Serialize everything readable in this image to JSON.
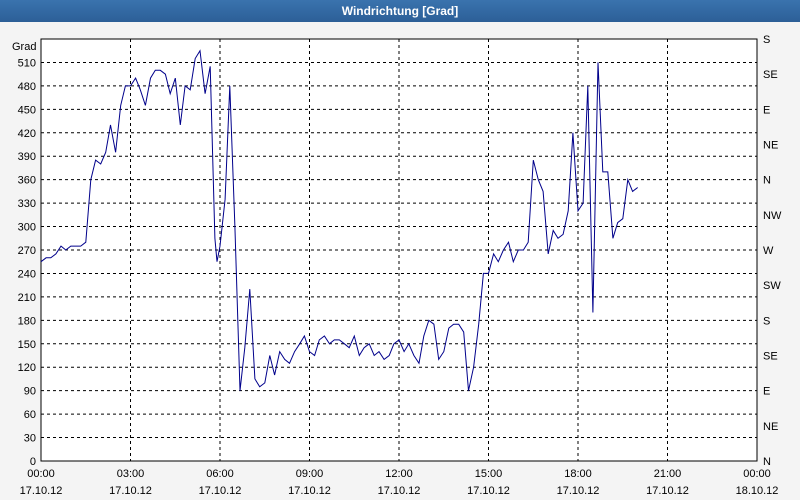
{
  "window": {
    "title": "Windrichtung [Grad]"
  },
  "chart_data": {
    "type": "line",
    "title": "Windrichtung [Grad]",
    "ylabel": "Grad",
    "ylim": [
      0,
      540
    ],
    "grid": true,
    "y_ticks": [
      "0",
      "30",
      "60",
      "90",
      "120",
      "150",
      "180",
      "210",
      "240",
      "270",
      "300",
      "330",
      "360",
      "390",
      "420",
      "450",
      "480",
      "510"
    ],
    "right_ticks": [
      "N",
      "NE",
      "E",
      "SE",
      "S",
      "SW",
      "W",
      "NW",
      "N",
      "NE",
      "E",
      "SE",
      "S"
    ],
    "x_ticks": [
      {
        "time": "00:00",
        "date": "17.10.12"
      },
      {
        "time": "03:00",
        "date": "17.10.12"
      },
      {
        "time": "06:00",
        "date": "17.10.12"
      },
      {
        "time": "09:00",
        "date": "17.10.12"
      },
      {
        "time": "12:00",
        "date": "17.10.12"
      },
      {
        "time": "15:00",
        "date": "17.10.12"
      },
      {
        "time": "18:00",
        "date": "17.10.12"
      },
      {
        "time": "21:00",
        "date": "17.10.12"
      },
      {
        "time": "00:00",
        "date": "18.10.12"
      }
    ],
    "line_color": "#00008b",
    "x_hours": [
      0,
      0.17,
      0.33,
      0.5,
      0.67,
      0.83,
      1.0,
      1.17,
      1.33,
      1.5,
      1.67,
      1.83,
      2.0,
      2.17,
      2.33,
      2.5,
      2.67,
      2.83,
      3.0,
      3.17,
      3.33,
      3.5,
      3.67,
      3.83,
      4.0,
      4.17,
      4.33,
      4.5,
      4.67,
      4.83,
      5.0,
      5.17,
      5.33,
      5.5,
      5.67,
      5.83,
      5.9,
      6.0,
      6.17,
      6.33,
      6.5,
      6.67,
      6.83,
      7.0,
      7.17,
      7.33,
      7.5,
      7.67,
      7.83,
      8.0,
      8.17,
      8.33,
      8.5,
      8.67,
      8.83,
      9.0,
      9.17,
      9.33,
      9.5,
      9.67,
      9.83,
      10.0,
      10.17,
      10.33,
      10.5,
      10.67,
      10.83,
      11.0,
      11.17,
      11.33,
      11.5,
      11.67,
      11.83,
      12.0,
      12.17,
      12.33,
      12.5,
      12.67,
      12.83,
      13.0,
      13.17,
      13.33,
      13.5,
      13.67,
      13.83,
      14.0,
      14.17,
      14.33,
      14.5,
      14.67,
      14.83,
      15.0,
      15.17,
      15.33,
      15.5,
      15.67,
      15.83,
      16.0,
      16.17,
      16.33,
      16.5,
      16.67,
      16.83,
      17.0,
      17.17,
      17.33,
      17.5,
      17.67,
      17.83,
      18.0,
      18.17,
      18.33,
      18.5,
      18.67,
      18.83,
      19.0,
      19.17,
      19.33,
      19.5,
      19.67,
      19.83,
      20.0,
      20.17,
      20.33,
      20.5,
      20.67,
      20.83,
      21.0,
      21.17,
      21.33,
      21.5,
      21.67,
      21.83,
      22.0,
      22.17,
      22.33,
      22.5,
      22.67,
      22.83,
      23.0,
      23.17,
      23.33,
      23.5,
      23.67,
      23.83,
      24.0
    ],
    "values": [
      255,
      260,
      260,
      265,
      275,
      270,
      275,
      275,
      275,
      280,
      360,
      385,
      380,
      395,
      430,
      395,
      455,
      480,
      480,
      490,
      475,
      455,
      490,
      500,
      500,
      495,
      470,
      490,
      430,
      480,
      475,
      515,
      525,
      470,
      505,
      285,
      255,
      275,
      335,
      480,
      300,
      90,
      145,
      220,
      105,
      95,
      100,
      135,
      110,
      140,
      130,
      125,
      140,
      150,
      160,
      140,
      135,
      155,
      160,
      150,
      155,
      155,
      150,
      145,
      160,
      135,
      145,
      150,
      135,
      140,
      130,
      135,
      150,
      155,
      140,
      150,
      135,
      125,
      160,
      180,
      175,
      130,
      140,
      170,
      175,
      175,
      165,
      90,
      120,
      175,
      240,
      240,
      265,
      255,
      270,
      280,
      255,
      270,
      270,
      280,
      385,
      360,
      345,
      265,
      295,
      285,
      290,
      320,
      420,
      320,
      330,
      480,
      190,
      510,
      370,
      370,
      285,
      305,
      310,
      360,
      345,
      350
    ]
  }
}
